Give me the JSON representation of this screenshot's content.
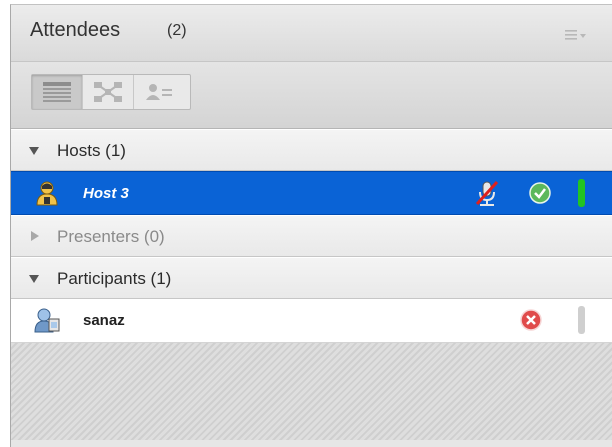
{
  "pod": {
    "title": "Attendees",
    "count": "(2)",
    "menu_icon": "pod-options-menu-icon"
  },
  "toolbar": {
    "views": [
      {
        "name": "list-view-icon",
        "active": true
      },
      {
        "name": "breakout-view-icon",
        "active": false
      },
      {
        "name": "status-view-icon",
        "active": false
      }
    ]
  },
  "sections": {
    "hosts": {
      "label": "Hosts (1)",
      "expanded": true
    },
    "presenters": {
      "label": "Presenters (0)",
      "expanded": false
    },
    "participants": {
      "label": "Participants (1)",
      "expanded": true
    }
  },
  "attendees": {
    "host": {
      "name": "Host 3",
      "role": "host",
      "selected": true,
      "mic": "microphone-muted-icon",
      "status": "agree-check-icon",
      "status_color": "#5cb85c",
      "activity_color": "#22c422"
    },
    "participant": {
      "name": "sanaz",
      "role": "participant",
      "selected": false,
      "status": "disagree-x-icon",
      "status_color": "#e04b4b",
      "activity_color": "#cfcfcf"
    }
  },
  "colors": {
    "selection": "#0a63d6",
    "header_bg": "#e2e2e2"
  }
}
